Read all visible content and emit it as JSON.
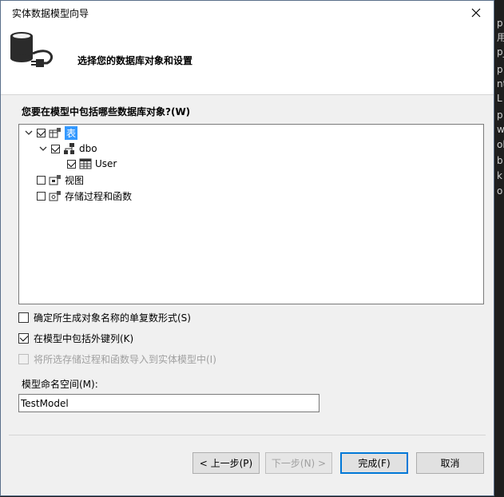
{
  "window": {
    "title": "实体数据模型向导"
  },
  "header": {
    "text": "选择您的数据库对象和设置"
  },
  "objects_section": {
    "label": "您要在模型中包括哪些数据库对象?(W)"
  },
  "tree": {
    "tables": {
      "label": "表",
      "checked": true
    },
    "dbo": {
      "label": "dbo",
      "checked": true
    },
    "user": {
      "label": "User",
      "checked": true
    },
    "views": {
      "label": "视图",
      "checked": false
    },
    "procs": {
      "label": "存储过程和函数",
      "checked": false
    }
  },
  "options": {
    "pluralize": "确定所生成对象名称的单复数形式(S)",
    "foreign_keys": "在模型中包括外键列(K)",
    "import_procs": "将所选存储过程和函数导入到实体模型中(I)"
  },
  "namespace": {
    "label": "模型命名空间(M):",
    "value": "TestModel"
  },
  "buttons": {
    "prev": "< 上一步(P)",
    "next": "下一步(N) >",
    "finish": "完成(F)",
    "cancel": "取消"
  },
  "background_chars": [
    "p",
    "用",
    "p_",
    "p",
    "nt",
    "L",
    "p",
    "w",
    "ol",
    "b",
    "k",
    "o"
  ],
  "colors": {
    "accent": "#0078d7",
    "selection": "#3399ff"
  }
}
